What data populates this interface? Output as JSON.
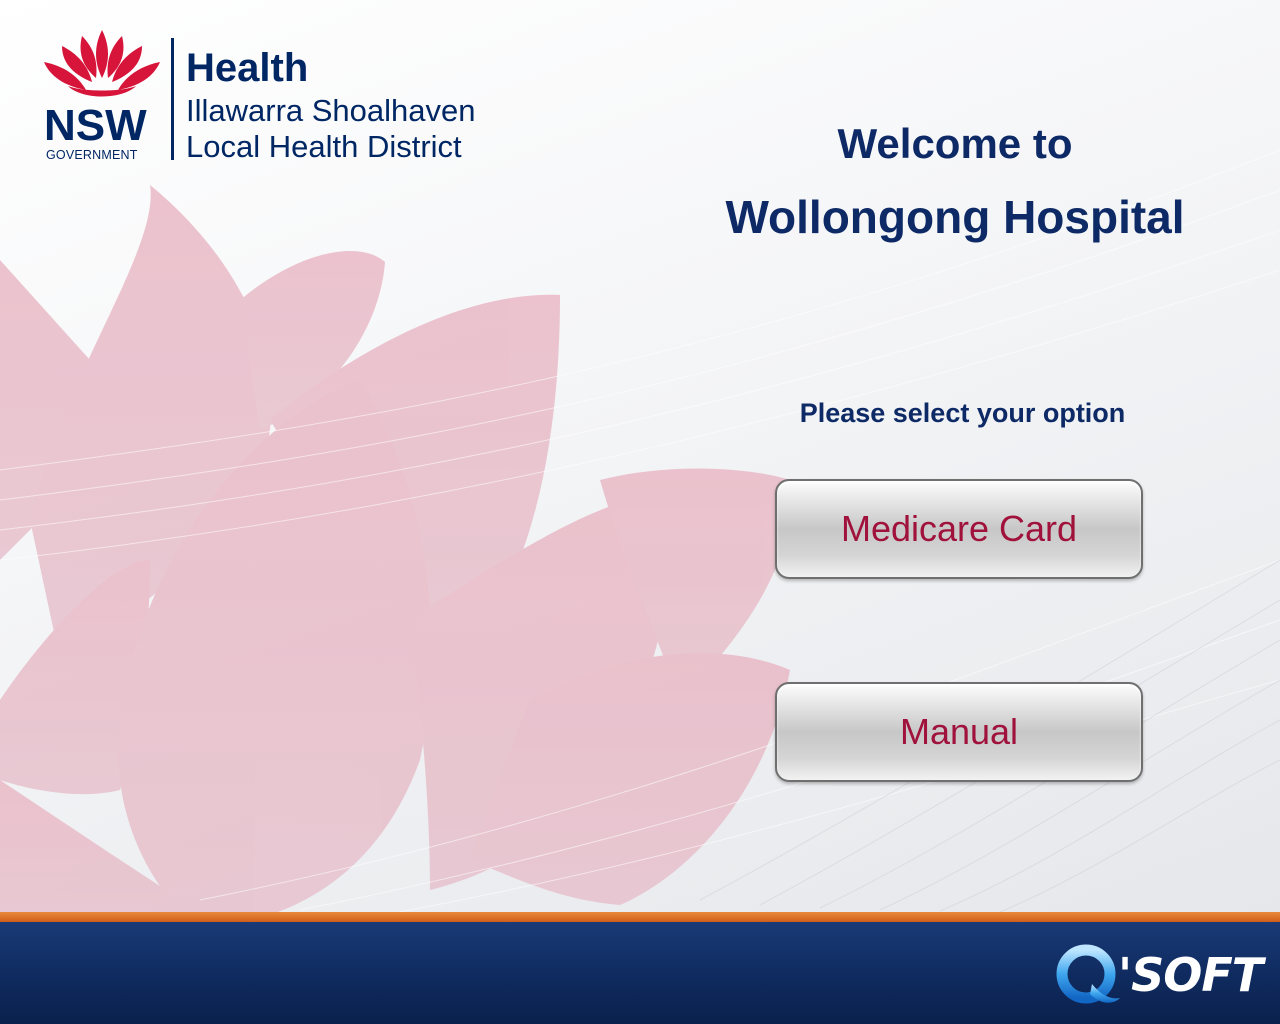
{
  "brand": {
    "nsw": "NSW",
    "government": "GOVERNMENT",
    "health": "Health",
    "district_line1": "Illawarra Shoalhaven",
    "district_line2": "Local Health District"
  },
  "welcome": {
    "line1": "Welcome to",
    "hospital": "Wollongong Hospital"
  },
  "prompt": "Please select your option",
  "options": [
    {
      "label": "Medicare Card"
    },
    {
      "label": "Manual"
    }
  ],
  "footer": {
    "logo_text": "'SOFT"
  },
  "colors": {
    "navy": "#0d2a66",
    "button_text": "#a0123c",
    "waratah_red": "#d7153a",
    "footer_orange": "#d9691f",
    "footer_navy": "#0f2a5e"
  }
}
